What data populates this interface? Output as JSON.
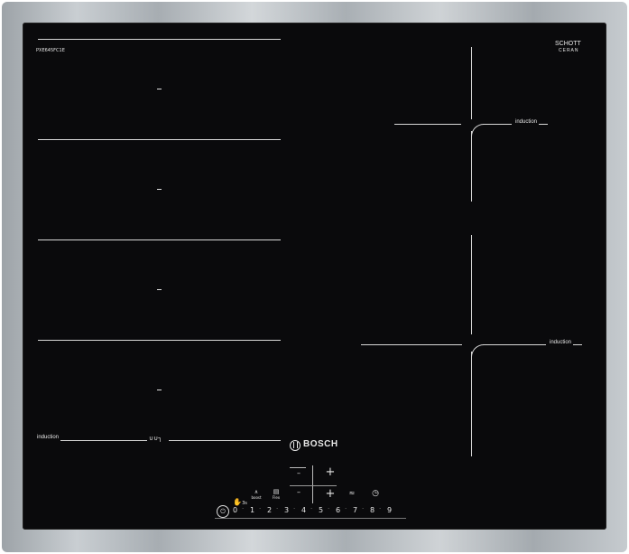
{
  "brand": {
    "logo_text": "BOSCH"
  },
  "model": {
    "code": "PXE645FC1E"
  },
  "glass_maker": {
    "line1": "SCHOTT",
    "line2": "CERAN",
    "sub": ""
  },
  "zones": {
    "left_label": "induction",
    "right_top_label": "induction",
    "right_bottom_label": "induction",
    "flex_symbol": "∪∪┐"
  },
  "controls": {
    "child_lock_label": "✋",
    "child_lock_sub": "3s",
    "boost_icon": "∧",
    "boost_label": "boost",
    "flex_icon": "▤",
    "flex_label": "Flex",
    "minus_top": "–",
    "plus_top": "+",
    "minus_bottom": "–",
    "plus_bottom": "+",
    "frying_icon": "≈",
    "timer_icon": "◷",
    "power_icon": "⏻"
  },
  "power_scale": [
    "0",
    "1",
    "2",
    "3",
    "4",
    "5",
    "6",
    "7",
    "8",
    "9"
  ]
}
